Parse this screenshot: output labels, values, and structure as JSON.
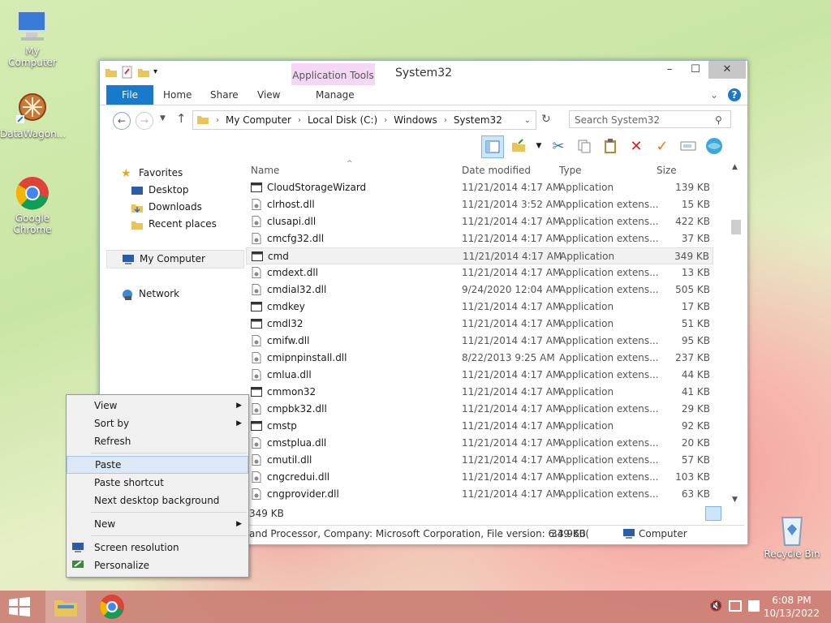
{
  "desktop": {
    "icons": [
      "My Computer",
      "DataWagon...",
      "Google Chrome",
      "Recycle Bin"
    ]
  },
  "window": {
    "title": "System32",
    "controls": [
      "–",
      "☐",
      "✕"
    ],
    "ribbon": {
      "file": "File",
      "home": "Home",
      "share": "Share",
      "view": "View",
      "contextual_group": "Application Tools",
      "manage": "Manage"
    },
    "address": {
      "crumbs": [
        "My Computer",
        "Local Disk (C:)",
        "Windows",
        "System32"
      ],
      "search_placeholder": "Search System32"
    },
    "sidebar": {
      "favorites": "Favorites",
      "desktop": "Desktop",
      "downloads": "Downloads",
      "recent": "Recent places",
      "computer": "My Computer",
      "network": "Network"
    },
    "columns": {
      "name": "Name",
      "date": "Date modified",
      "type": "Type",
      "size": "Size"
    },
    "files": [
      {
        "name": "CloudStorageWizard",
        "date": "11/21/2014 4:17 AM",
        "type": "Application",
        "size": "139 KB"
      },
      {
        "name": "clrhost.dll",
        "date": "11/21/2014 3:52 AM",
        "type": "Application extens...",
        "size": "15 KB"
      },
      {
        "name": "clusapi.dll",
        "date": "11/21/2014 4:17 AM",
        "type": "Application extens...",
        "size": "422 KB"
      },
      {
        "name": "cmcfg32.dll",
        "date": "11/21/2014 4:17 AM",
        "type": "Application extens...",
        "size": "37 KB"
      },
      {
        "name": "cmd",
        "date": "11/21/2014 4:17 AM",
        "type": "Application",
        "size": "349 KB"
      },
      {
        "name": "cmdext.dll",
        "date": "11/21/2014 4:17 AM",
        "type": "Application extens...",
        "size": "13 KB"
      },
      {
        "name": "cmdial32.dll",
        "date": "9/24/2020 12:04 AM",
        "type": "Application extens...",
        "size": "505 KB"
      },
      {
        "name": "cmdkey",
        "date": "11/21/2014 4:17 AM",
        "type": "Application",
        "size": "17 KB"
      },
      {
        "name": "cmdl32",
        "date": "11/21/2014 4:17 AM",
        "type": "Application",
        "size": "51 KB"
      },
      {
        "name": "cmifw.dll",
        "date": "11/21/2014 4:17 AM",
        "type": "Application extens...",
        "size": "95 KB"
      },
      {
        "name": "cmipnpinstall.dll",
        "date": "8/22/2013 9:25 AM",
        "type": "Application extens...",
        "size": "237 KB"
      },
      {
        "name": "cmlua.dll",
        "date": "11/21/2014 4:17 AM",
        "type": "Application extens...",
        "size": "44 KB"
      },
      {
        "name": "cmmon32",
        "date": "11/21/2014 4:17 AM",
        "type": "Application",
        "size": "41 KB"
      },
      {
        "name": "cmpbk32.dll",
        "date": "11/21/2014 4:17 AM",
        "type": "Application extens...",
        "size": "29 KB"
      },
      {
        "name": "cmstp",
        "date": "11/21/2014 4:17 AM",
        "type": "Application",
        "size": "92 KB"
      },
      {
        "name": "cmstplua.dll",
        "date": "11/21/2014 4:17 AM",
        "type": "Application extens...",
        "size": "20 KB"
      },
      {
        "name": "cmutil.dll",
        "date": "11/21/2014 4:17 AM",
        "type": "Application extens...",
        "size": "57 KB"
      },
      {
        "name": "cngcredui.dll",
        "date": "11/21/2014 4:17 AM",
        "type": "Application extens...",
        "size": "103 KB"
      },
      {
        "name": "cngprovider.dll",
        "date": "11/21/2014 4:17 AM",
        "type": "Application extens...",
        "size": "63 KB"
      }
    ],
    "selected_size": "349 KB",
    "status": {
      "details": "and Processor, Company: Microsoft Corporation, File version: 6.3.960(",
      "size": "349 KB",
      "location": "Computer"
    }
  },
  "context_menu": {
    "view": "View",
    "sort_by": "Sort by",
    "refresh": "Refresh",
    "paste": "Paste",
    "paste_shortcut": "Paste shortcut",
    "next_bg": "Next desktop background",
    "new": "New",
    "screen_resolution": "Screen resolution",
    "personalize": "Personalize"
  },
  "taskbar": {
    "time": "6:08 PM",
    "date": "10/13/2022"
  }
}
